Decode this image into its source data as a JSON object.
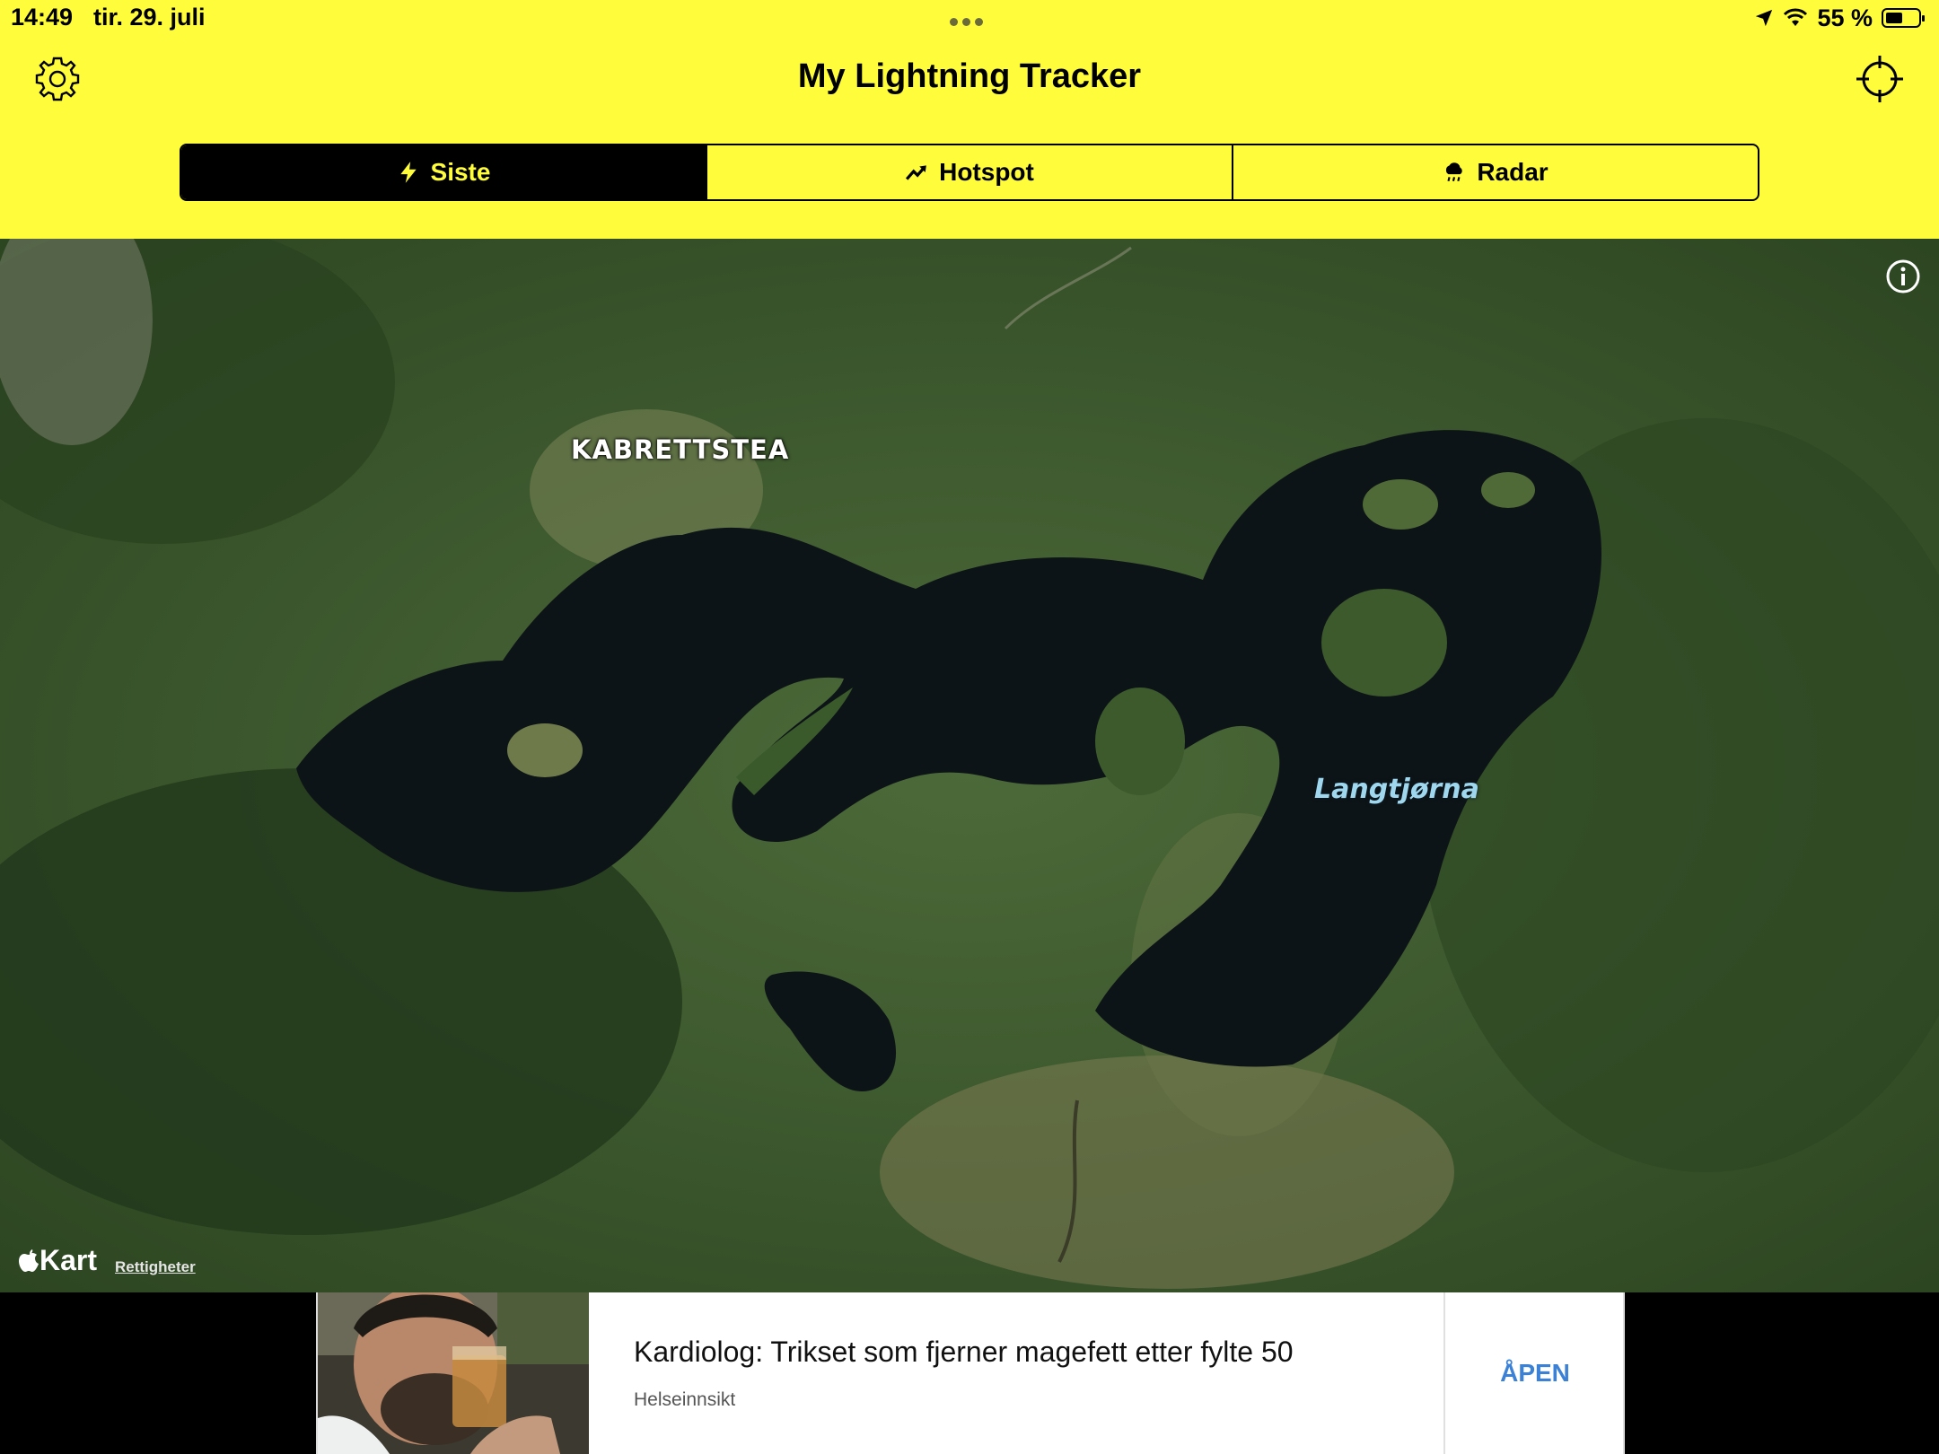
{
  "status_bar": {
    "time": "14:49",
    "date": "tir. 29. juli",
    "battery": "55 %",
    "battery_level": 0.55
  },
  "header": {
    "title": "My Lightning Tracker",
    "settings_icon": "gear-icon",
    "locate_icon": "crosshair-icon",
    "background": "#FFFD3B"
  },
  "tabs": [
    {
      "label": "Siste",
      "icon": "lightning-bolt-icon",
      "selected": true
    },
    {
      "label": "Hotspot",
      "icon": "trend-arrow-icon",
      "selected": false
    },
    {
      "label": "Radar",
      "icon": "rain-cloud-icon",
      "selected": false
    }
  ],
  "map": {
    "labels": {
      "kabrettstea": "KABRETTSTEA",
      "langtjorna": "Langtjørna"
    },
    "logo": "Kart",
    "rights_link": "Rettigheter",
    "info_icon": "info-icon"
  },
  "ad": {
    "title": "Kardiolog: Trikset som fjerner magefett etter fylte 50",
    "source": "Helseinnsikt",
    "cta": "ÅPEN",
    "accent": "#3b82d6"
  }
}
